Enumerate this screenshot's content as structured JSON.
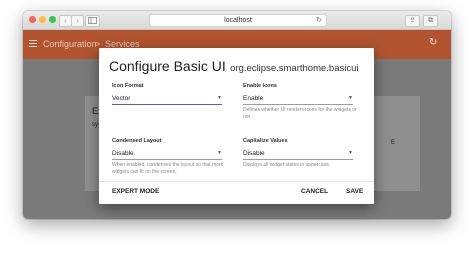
{
  "browser": {
    "url": "localhost",
    "new_tab_glyph": "+"
  },
  "app": {
    "crumbs": [
      "Configuration",
      ">",
      "Services"
    ],
    "card": {
      "title": "Ex",
      "subtitle": "sys",
      "action": "E"
    }
  },
  "dialog": {
    "title_main": "Configure Basic UI",
    "title_sub": "org.eclipse.smarthome.basicui",
    "fields": [
      {
        "label": "Icon Format",
        "value": "Vector",
        "help": ""
      },
      {
        "label": "Enable Icons",
        "value": "Enable",
        "help": "Defines whether UI renders icons for the widgets or not."
      },
      {
        "label": "Condensed Layout",
        "value": "Disable",
        "help": "When enabled, condenses the layout so that more widgets can fit on the screen."
      },
      {
        "label": "Capitalize Values",
        "value": "Disable",
        "help": "Displays all widget states in uppercase."
      }
    ],
    "expert_mode_label": "EXPERT MODE",
    "cancel_label": "CANCEL",
    "save_label": "SAVE"
  },
  "colors": {
    "appbar": "#b2542f",
    "accent": "#4a68a8",
    "overlay": "#7a7a7a"
  }
}
